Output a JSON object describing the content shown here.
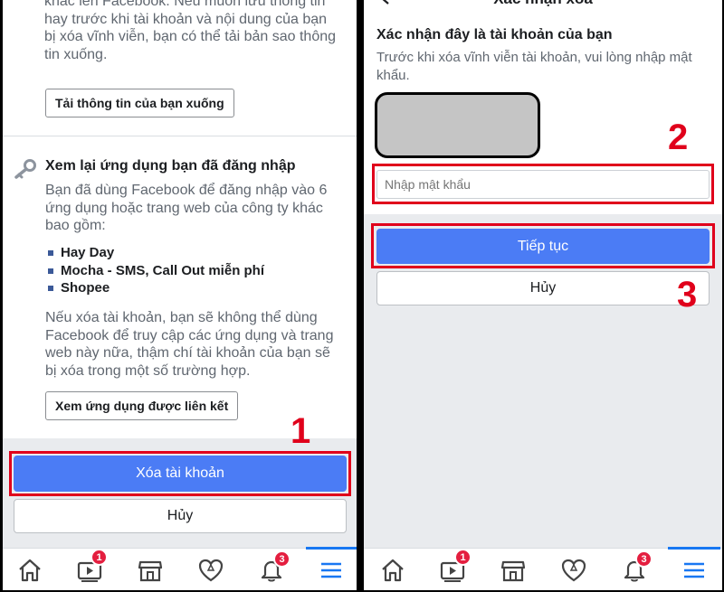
{
  "left": {
    "download_section": {
      "text": "khác lên Facebook. Nếu muốn lưu thông tin hay trước khi tài khoản và nội dung của bạn bị xóa vĩnh viễn, bạn có thể tải bản sao thông tin xuống.",
      "button_label": "Tải thông tin của bạn xuống"
    },
    "apps_section": {
      "title": "Xem lại ứng dụng bạn đã đăng nhập",
      "description": "Bạn đã dùng Facebook để đăng nhập vào 6 ứng dụng hoặc trang web của công ty khác bao gồm:",
      "apps": [
        "Hay Day",
        "Mocha - SMS, Call Out miễn phí",
        "Shopee"
      ],
      "note": "Nếu xóa tài khoản, bạn sẽ không thể dùng Facebook để truy cập các ứng dụng và trang web này nữa, thậm chí tài khoản của bạn sẽ bị xóa trong một số trường hợp.",
      "button_label": "Xem ứng dụng được liên kết"
    },
    "delete_button": "Xóa tài khoản",
    "cancel_button": "Hủy",
    "step_label": "1"
  },
  "right": {
    "header_title": "Xác nhận xóa",
    "confirm_title": "Xác nhận đây là tài khoản của bạn",
    "confirm_text": "Trước khi xóa vĩnh viễn tài khoản, vui lòng nhập mật khẩu.",
    "password_placeholder": "Nhập mật khẩu",
    "continue_button": "Tiếp tục",
    "cancel_button": "Hủy",
    "step2_label": "2",
    "step3_label": "3"
  },
  "nav": {
    "items": [
      "home-icon",
      "watch-icon",
      "marketplace-icon",
      "dating-icon",
      "notifications-icon",
      "menu-icon"
    ],
    "watch_badge": "1",
    "notifications_badge": "3",
    "active_item": "menu-icon"
  },
  "colors": {
    "primary": "#4b7cf5",
    "annotation_red": "#e0001b",
    "badge_red": "#e41e3f"
  }
}
